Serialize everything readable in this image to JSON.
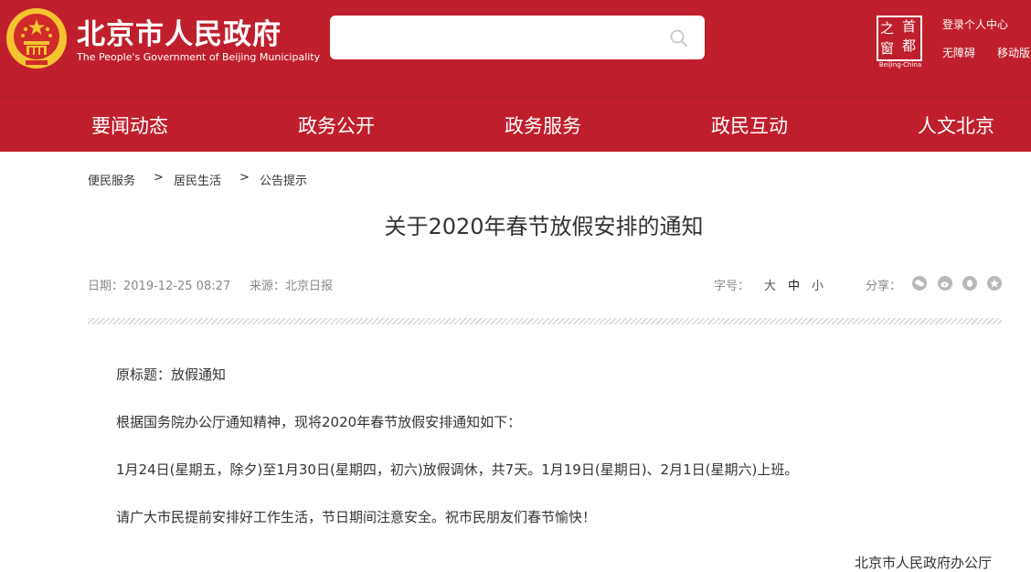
{
  "header": {
    "title": "北京市人民政府",
    "subtitle": "The People's Government of Beijing Municipality",
    "search": {
      "placeholder": ""
    },
    "capital_logo": {
      "chars": [
        "之",
        "首",
        "窗",
        "都"
      ],
      "subtitle": "Beijing-China"
    },
    "links": {
      "login": "登录个人中心",
      "accessibility": "无障碍",
      "mobile": "移动版"
    }
  },
  "nav": {
    "items": [
      {
        "label": "要闻动态"
      },
      {
        "label": "政务公开"
      },
      {
        "label": "政务服务"
      },
      {
        "label": "政民互动"
      },
      {
        "label": "人文北京"
      }
    ]
  },
  "breadcrumb": {
    "items": [
      "便民服务",
      "居民生活",
      "公告提示"
    ],
    "separator": ">"
  },
  "article": {
    "title": "关于2020年春节放假安排的通知",
    "date": "日期：2019-12-25 08:27",
    "source": "来源：北京日报",
    "font_size_label": "字号：",
    "font_sizes": [
      "大",
      "中",
      "小"
    ],
    "share_label": "分享：",
    "share_icons": [
      "wechat-icon",
      "weibo-icon",
      "qq-icon",
      "qzone-icon"
    ],
    "paragraphs": [
      "原标题：放假通知",
      "根据国务院办公厅通知精神，现将2020年春节放假安排通知如下：",
      "1月24日(星期五，除夕)至1月30日(星期四，初六)放假调休，共7天。1月19日(星期日)、2月1日(星期六)上班。",
      "请广大市民提前安排好工作生活，节日期间注意安全。祝市民朋友们春节愉快！"
    ],
    "signature": "北京市人民政府办公厅"
  },
  "colors": {
    "brand_red": "#bf1f2d",
    "emblem_gold": "#f4c430"
  }
}
